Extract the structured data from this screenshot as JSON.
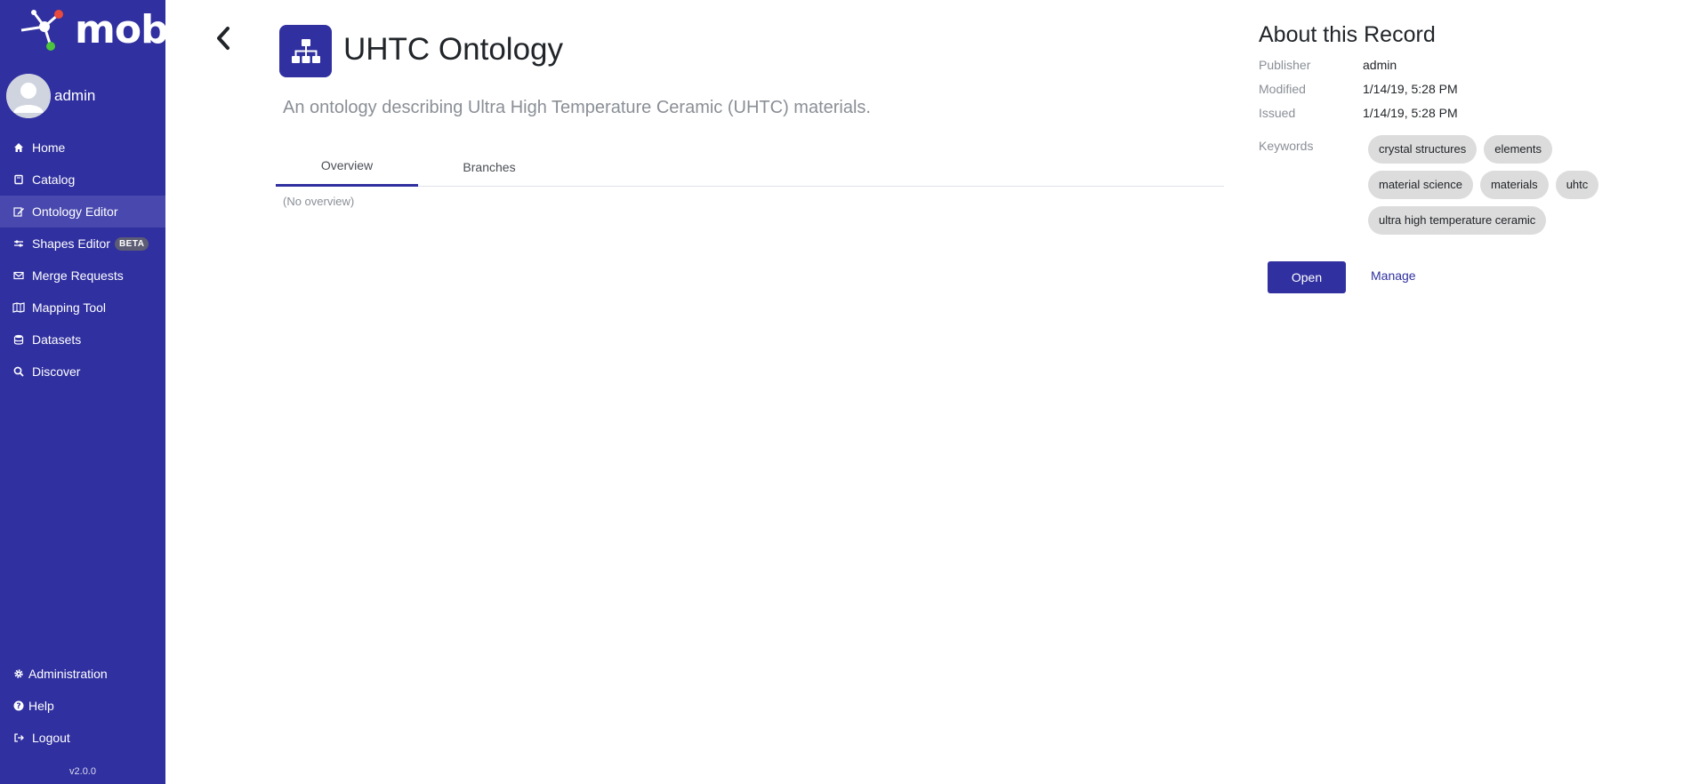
{
  "app": {
    "logo_text": "mobi",
    "version": "v2.0.0"
  },
  "user": {
    "name": "admin"
  },
  "nav": {
    "items": [
      {
        "label": "Home",
        "icon": "home-icon"
      },
      {
        "label": "Catalog",
        "icon": "book-icon"
      },
      {
        "label": "Ontology Editor",
        "icon": "edit-icon",
        "active": true
      },
      {
        "label": "Shapes Editor",
        "icon": "shapes-icon",
        "badge": "BETA"
      },
      {
        "label": "Merge Requests",
        "icon": "envelope-icon"
      },
      {
        "label": "Mapping Tool",
        "icon": "map-icon"
      },
      {
        "label": "Datasets",
        "icon": "database-icon"
      },
      {
        "label": "Discover",
        "icon": "search-icon"
      }
    ],
    "bottom": [
      {
        "label": "Administration",
        "icon": "gear-icon"
      },
      {
        "label": "Help",
        "icon": "question-icon"
      },
      {
        "label": "Logout",
        "icon": "logout-icon"
      }
    ]
  },
  "record": {
    "title": "UHTC Ontology",
    "description": "An ontology describing Ultra High Temperature Ceramic (UHTC) materials.",
    "tabs": [
      {
        "label": "Overview",
        "active": true
      },
      {
        "label": "Branches"
      }
    ],
    "overview_text": "(No overview)"
  },
  "about": {
    "title": "About this Record",
    "publisher_label": "Publisher",
    "publisher": "admin",
    "modified_label": "Modified",
    "modified": "1/14/19, 5:28 PM",
    "issued_label": "Issued",
    "issued": "1/14/19, 5:28 PM",
    "keywords_label": "Keywords",
    "keywords": [
      "crystal structures",
      "elements",
      "material science",
      "materials",
      "uhtc",
      "ultra high temperature ceramic"
    ],
    "open_label": "Open",
    "manage_label": "Manage"
  },
  "colors": {
    "brand": "#3030a0",
    "sidebar_active": "#4848ae",
    "chip": "#dcdcdc"
  }
}
